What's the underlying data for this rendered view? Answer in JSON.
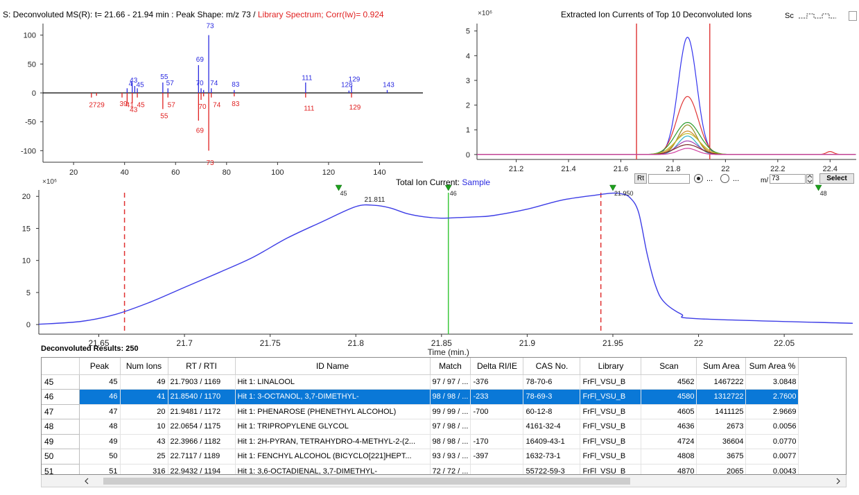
{
  "spectrum": {
    "title_prefix": "S: Deconvoluted MS(R): t= 21.66 - 21.94 min : Peak Shape: m/z  73 / ",
    "title_library": "Library Spectrum; Corr(Iw)= 0.924",
    "y_ticks": [
      "100",
      "50",
      "0",
      "-50",
      "-100"
    ],
    "x_ticks": [
      "20",
      "40",
      "60",
      "80",
      "100",
      "120",
      "140"
    ],
    "upper_labels": [
      {
        "mz": 43,
        "text": "43"
      },
      {
        "mz": 44,
        "text": "4"
      },
      {
        "mz": 45,
        "text": "45"
      },
      {
        "mz": 55,
        "text": "55"
      },
      {
        "mz": 57,
        "text": "57"
      },
      {
        "mz": 69,
        "text": "69"
      },
      {
        "mz": 70,
        "text": "70"
      },
      {
        "mz": 73,
        "text": "73"
      },
      {
        "mz": 74,
        "text": "74"
      },
      {
        "mz": 83,
        "text": "83"
      },
      {
        "mz": 111,
        "text": "111"
      },
      {
        "mz": 128,
        "text": "128"
      },
      {
        "mz": 129,
        "text": "129"
      },
      {
        "mz": 143,
        "text": "143"
      }
    ],
    "lower_labels": [
      {
        "mz": 27,
        "text": "27"
      },
      {
        "mz": 29,
        "text": "29"
      },
      {
        "mz": 39,
        "text": "39"
      },
      {
        "mz": 41,
        "text": "41"
      },
      {
        "mz": 43,
        "text": "43"
      },
      {
        "mz": 45,
        "text": "45"
      },
      {
        "mz": 55,
        "text": "55"
      },
      {
        "mz": 57,
        "text": "57"
      },
      {
        "mz": 69,
        "text": "69"
      },
      {
        "mz": 70,
        "text": "70"
      },
      {
        "mz": 73,
        "text": "73"
      },
      {
        "mz": 74,
        "text": "74"
      },
      {
        "mz": 83,
        "text": "83"
      },
      {
        "mz": 111,
        "text": "111"
      },
      {
        "mz": 129,
        "text": "129"
      }
    ],
    "sample_color": "#2a2ae0",
    "library_color": "#e02020"
  },
  "eic": {
    "title": "Extracted Ion Currents of Top 10 Deconvoluted Ions",
    "scale_label": "×10⁶",
    "sc_label": "Sc",
    "y_ticks": [
      "5",
      "4",
      "3",
      "2",
      "1",
      "0"
    ],
    "x_ticks": [
      "21.2",
      "21.4",
      "21.6",
      "21.8",
      "22",
      "22.2",
      "22.4"
    ],
    "rt_label": "Rt",
    "rt_value": "",
    "mz_label": "m/",
    "mz_value": "73",
    "select_label": "Select",
    "radio_1_label": "...",
    "radio_2_label": "..."
  },
  "chart_data": [
    {
      "type": "bar",
      "title": "S: Deconvoluted MS(R): t= 21.66 - 21.94 min : Peak Shape: m/z  73 / Library Spectrum; Corr(Iw)= 0.924",
      "xlabel": "",
      "ylabel": "",
      "xlim": [
        8,
        157
      ],
      "ylim": [
        -120,
        120
      ],
      "series": [
        {
          "name": "",
          "mz": [
            41,
            43,
            44,
            45,
            55,
            57,
            69,
            70,
            71,
            73,
            74,
            83,
            111,
            128,
            129,
            143
          ],
          "values": [
            8,
            18,
            12,
            8,
            18,
            8,
            48,
            8,
            5,
            100,
            8,
            5,
            18,
            4,
            12,
            5
          ]
        },
        {
          "name": "Library Spectrum",
          "mz": [
            27,
            29,
            39,
            41,
            43,
            45,
            55,
            57,
            69,
            70,
            71,
            73,
            74,
            83,
            111,
            129
          ],
          "values": [
            -8,
            -5,
            -8,
            -18,
            -18,
            -8,
            -28,
            -8,
            -48,
            -12,
            -6,
            -100,
            -8,
            -6,
            -8,
            -8
          ]
        }
      ]
    },
    {
      "type": "line",
      "title": "Extracted Ion Currents of Top 10 Deconvoluted Ions",
      "xlabel": "",
      "ylabel": "",
      "xlim": [
        21.05,
        22.5
      ],
      "ylim": [
        -0.2,
        5.3
      ],
      "markers_x": [
        21.66,
        21.94
      ],
      "series": [
        {
          "name": "",
          "peak": 4.75,
          "color": "#3333ee"
        },
        {
          "name": "",
          "peak": 2.35,
          "color": "#e03333"
        },
        {
          "name": "",
          "peak": 1.3,
          "color": "#2a9a2a"
        },
        {
          "name": "",
          "peak": 1.2,
          "color": "#8e8e20"
        },
        {
          "name": "",
          "peak": 0.95,
          "color": "#d08a2a"
        },
        {
          "name": "",
          "peak": 0.85,
          "color": "#bfbf30"
        },
        {
          "name": "",
          "peak": 0.75,
          "color": "#2ab0c8"
        },
        {
          "name": "",
          "peak": 0.55,
          "color": "#a040b0"
        },
        {
          "name": "",
          "peak": 0.4,
          "color": "#7a2a2a"
        },
        {
          "name": "",
          "peak": 0.25,
          "color": "#d040a0"
        }
      ]
    },
    {
      "type": "line",
      "title": "Total Ion Current: Sample",
      "xlabel": "Time (min.)",
      "ylabel": "",
      "xlim": [
        21.615,
        22.09
      ],
      "ylim": [
        -1.5,
        21
      ],
      "x": [
        21.615,
        21.64,
        21.66,
        21.68,
        21.7,
        21.72,
        21.74,
        21.76,
        21.78,
        21.8,
        21.811,
        21.82,
        21.83,
        21.84,
        21.85,
        21.86,
        21.87,
        21.88,
        21.9,
        21.92,
        21.94,
        21.95,
        21.955,
        21.96,
        21.965,
        21.97,
        21.975,
        21.98,
        21.99,
        22.0,
        22.09
      ],
      "values": [
        0.05,
        0.5,
        1.6,
        3.5,
        5.8,
        8.1,
        10.5,
        13.5,
        16.0,
        18.4,
        18.6,
        18.2,
        17.3,
        16.8,
        16.6,
        16.7,
        16.8,
        17.0,
        18.0,
        19.4,
        20.2,
        20.5,
        20.4,
        19.8,
        17.5,
        11.0,
        6.0,
        3.5,
        1.6,
        0.9,
        0.2
      ],
      "markers_x": [
        21.665,
        21.943
      ],
      "selected_x": 21.854,
      "peak_label": {
        "x": 21.811,
        "y": 18.6,
        "text": "21.811"
      }
    }
  ],
  "tic": {
    "title_prefix": "Total Ion Current: ",
    "title_sample": "Sample",
    "scale_label": "×10⁶",
    "y_ticks": [
      "20",
      "15",
      "10",
      "5",
      "0"
    ],
    "x_ticks": [
      "21.65",
      "21.7",
      "21.75",
      "21.8",
      "21.85",
      "21.9",
      "21.95",
      "22",
      "22.05"
    ],
    "xlabel": "Time (min.)",
    "peak_label": "21.811",
    "peak_markers": [
      {
        "x": 21.79,
        "text": "45"
      },
      {
        "x": 21.854,
        "text": "46"
      },
      {
        "x": 21.95,
        "text": "21.950"
      },
      {
        "x": 22.07,
        "text": "48"
      }
    ]
  },
  "results": {
    "label": "Deconvoluted Results: 250",
    "columns": [
      "Peak",
      "Num Ions",
      "RT / RTI",
      "ID Name",
      "Match",
      "Delta RI/IE",
      "CAS No.",
      "Library",
      "Scan",
      "Sum Area",
      "Sum Area %"
    ],
    "rows": [
      {
        "row": "45",
        "cells": [
          "45",
          "49",
          "21.7903 / 1169",
          "Hit  1: LINALOOL",
          "97 / 97 / ...",
          "-376",
          "78-70-6",
          "FrFl_VSU_B",
          "4562",
          "1467222",
          "3.0848"
        ]
      },
      {
        "row": "46",
        "cells": [
          "46",
          "41",
          "21.8540 / 1170",
          "Hit  1: 3-OCTANOL, 3,7-DIMETHYL-",
          "98 / 98 / ...",
          "-233",
          "78-69-3",
          "FrFl_VSU_B",
          "4580",
          "1312722",
          "2.7600"
        ]
      },
      {
        "row": "47",
        "cells": [
          "47",
          "20",
          "21.9481 / 1172",
          "Hit  1: PHENAROSE (PHENETHYL ALCOHOL)",
          "99 / 99 / ...",
          "-700",
          "60-12-8",
          "FrFl_VSU_B",
          "4605",
          "1411125",
          "2.9669"
        ]
      },
      {
        "row": "48",
        "cells": [
          "48",
          "10",
          "22.0654 / 1175",
          "Hit  1: TRIPROPYLENE GLYCOL",
          "97 / 98 / ...",
          "",
          "4161-32-4",
          "FrFl_VSU_B",
          "4636",
          "2673",
          "0.0056"
        ]
      },
      {
        "row": "49",
        "cells": [
          "49",
          "43",
          "22.3966 / 1182",
          "Hit  1: 2H-PYRAN, TETRAHYDRO-4-METHYL-2-(2...",
          "98 / 98 / ...",
          "-170",
          "16409-43-1",
          "FrFl_VSU_B",
          "4724",
          "36604",
          "0.0770"
        ]
      },
      {
        "row": "50",
        "cells": [
          "50",
          "25",
          "22.7117 / 1189",
          "Hit  1: FENCHYL ALCOHOL (BICYCLO[221]HEPT...",
          "93 / 93 / ...",
          "-397",
          "1632-73-1",
          "FrFl_VSU_B",
          "4808",
          "3675",
          "0.0077"
        ]
      },
      {
        "row": "51",
        "cells": [
          "51",
          "316",
          "22.9432 / 1194",
          "Hit  1: 3,6-OCTADIENAL, 3,7-DIMETHYL-",
          "72 / 72 / ...",
          "",
          "55722-59-3",
          "FrFl_VSU_B",
          "4870",
          "2065",
          "0.0043"
        ]
      }
    ],
    "selected_row": "46",
    "selection_color": "#0a78d7"
  }
}
